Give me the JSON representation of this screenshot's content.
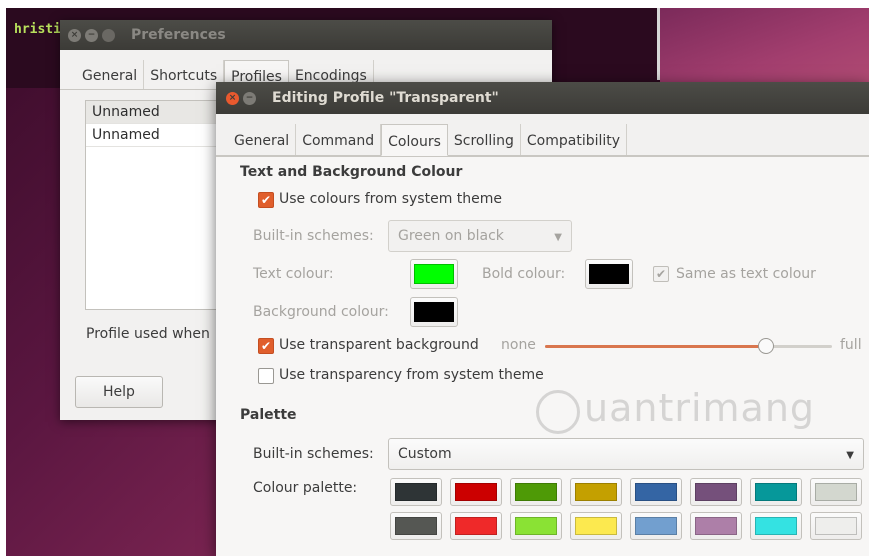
{
  "terminal": {
    "text": "hristi"
  },
  "preferences": {
    "title": "Preferences",
    "tabs": [
      "General",
      "Shortcuts",
      "Profiles",
      "Encodings"
    ],
    "profiles": [
      "Unnamed",
      "Unnamed"
    ],
    "profile_used_label": "Profile used when",
    "help_label": "Help"
  },
  "editor": {
    "title": "Editing Profile \"Transparent\"",
    "tabs": [
      "General",
      "Command",
      "Colours",
      "Scrolling",
      "Compatibility"
    ],
    "active_tab": "Colours",
    "section_text_bg": "Text and Background Colour",
    "use_system_colours": {
      "label": "Use colours from system theme",
      "checked": true
    },
    "builtin_schemes_label": "Built-in schemes:",
    "builtin_schemes_value": "Green on black",
    "text_colour_label": "Text colour:",
    "text_colour": "#00ff00",
    "bold_colour_label": "Bold colour:",
    "bold_colour": "#000000",
    "same_as_text": {
      "label": "Same as text colour",
      "checked": true
    },
    "background_colour_label": "Background colour:",
    "background_colour": "#000000",
    "use_transparent_bg": {
      "label": "Use transparent background",
      "checked": true
    },
    "transparency": {
      "min_label": "none",
      "max_label": "full",
      "level": 0.77
    },
    "use_system_transparency": {
      "label": "Use transparency from system theme",
      "checked": false
    },
    "section_palette": "Palette",
    "palette_schemes_label": "Built-in schemes:",
    "palette_schemes_value": "Custom",
    "colour_palette_label": "Colour palette:",
    "palette": [
      "#2e3436",
      "#cc0000",
      "#4e9a06",
      "#c4a000",
      "#3465a4",
      "#75507b",
      "#06989a",
      "#d3d7cf",
      "#555753",
      "#ef2929",
      "#8ae234",
      "#fce94f",
      "#729fcf",
      "#ad7fa8",
      "#34e2e2",
      "#eeeeec"
    ]
  },
  "watermark": "uantrimang"
}
